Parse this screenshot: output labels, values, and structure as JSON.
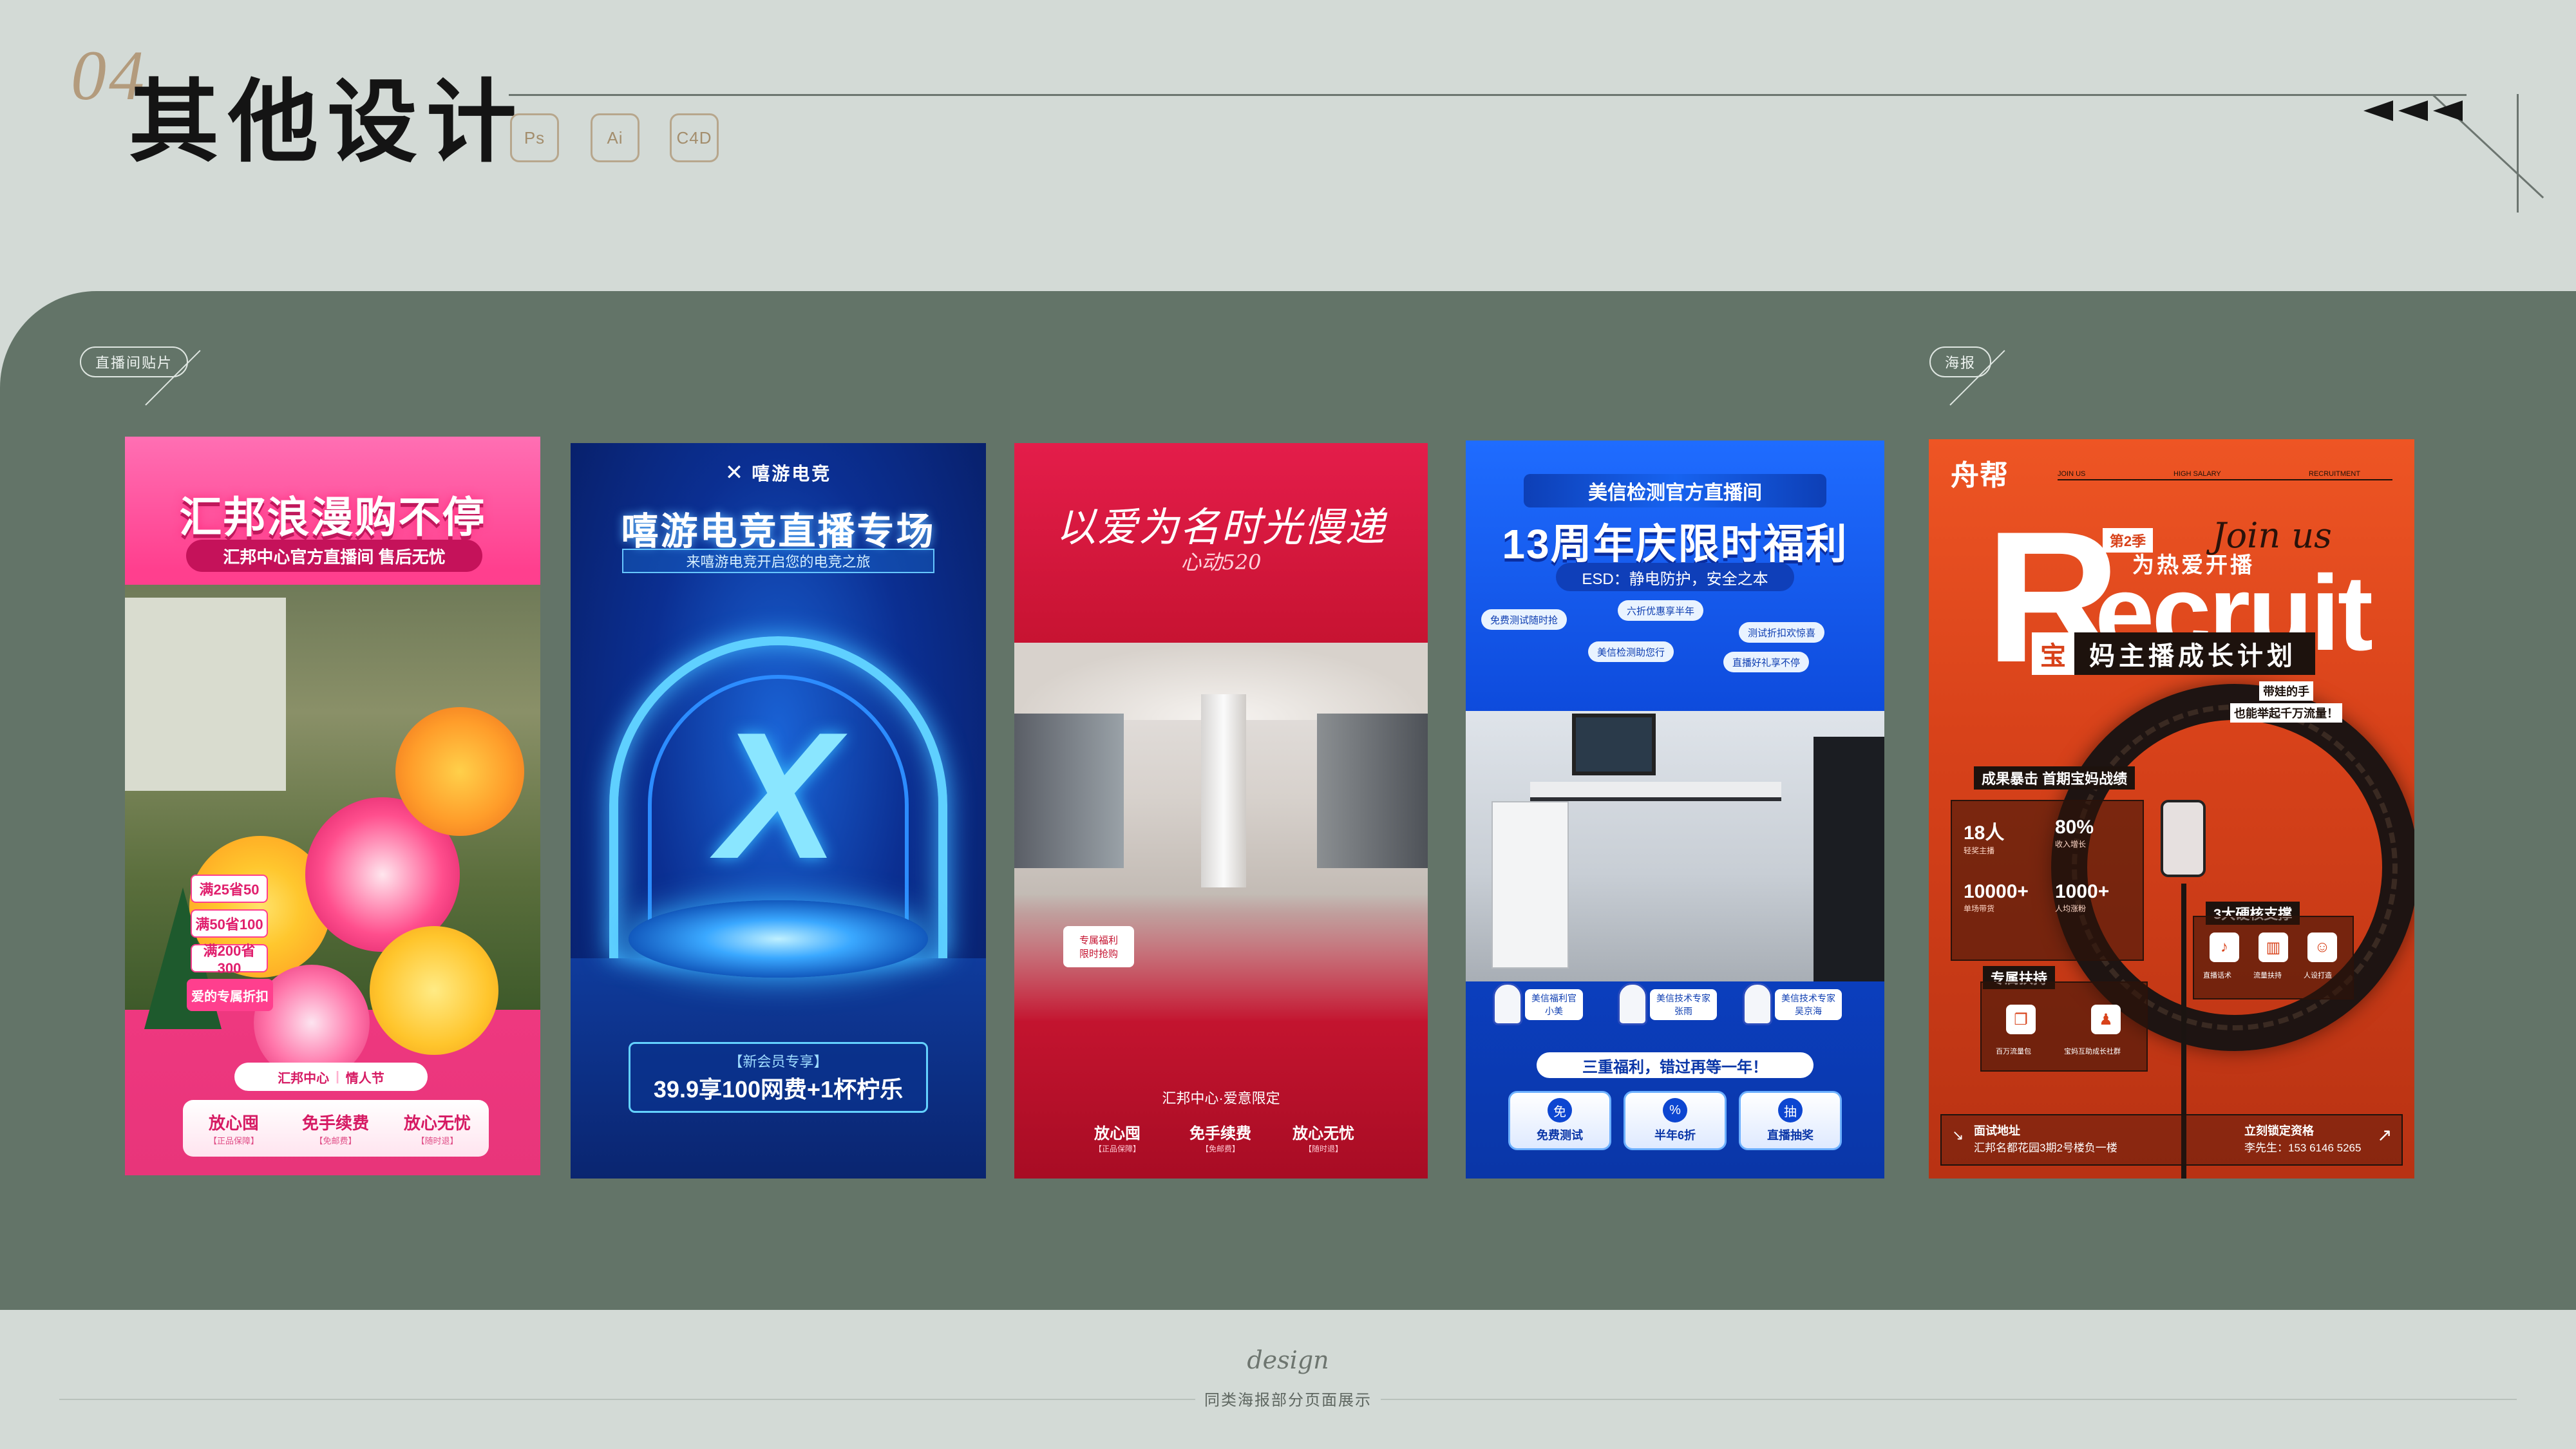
{
  "header": {
    "section_number": "04",
    "title": "其他设计",
    "tools": [
      "Ps",
      "Ai",
      "C4D"
    ]
  },
  "sections": {
    "left_label": "直播间贴片",
    "right_label": "海报"
  },
  "posters": {
    "p1": {
      "title": "汇邦浪漫购不停",
      "subtitle": "汇邦中心官方直播间 售后无忧",
      "brand": "汇邦中心",
      "event": "情人节",
      "prices": [
        "满25省50",
        "满50省100",
        "满200省300"
      ],
      "promo": "爱的专属折扣",
      "guarantees": [
        {
          "main": "放心囤",
          "sub": "【正品保障】"
        },
        {
          "main": "免手续费",
          "sub": "【免邮费】"
        },
        {
          "main": "放心无忧",
          "sub": "【随时退】"
        }
      ],
      "colors": {
        "primary": "#ff3f8e",
        "deep": "#c5125a"
      }
    },
    "p2": {
      "logo": "嘻游电竞",
      "title": "嘻游电竞直播专场",
      "subtitle": "来嘻游电竞开启您的电竞之旅",
      "mark": "X",
      "promo_tag": "【新会员专享】",
      "promo": "39.9享100网费+1杯柠乐",
      "colors": {
        "primary": "#0b2f92",
        "glow": "#5fd0ff"
      }
    },
    "p3": {
      "title": "以爱为名时光慢递",
      "signature": "心动520",
      "tag_line1": "专属福利",
      "tag_line2": "限时抢购",
      "brand": "汇邦中心·爱意限定",
      "guarantees": [
        {
          "main": "放心囤",
          "sub": "【正品保障】"
        },
        {
          "main": "免手续费",
          "sub": "【免邮费】"
        },
        {
          "main": "放心无忧",
          "sub": "【随时退】"
        }
      ],
      "colors": {
        "primary": "#c4122f"
      }
    },
    "p4": {
      "subtitle": "美信检测官方直播间",
      "title": "13周年庆限时福利",
      "esd": "ESD：静电防护，安全之本",
      "chips": [
        "免费测试随时抢",
        "六折优惠享半年",
        "美信检测助您行",
        "测试折扣欢惊喜",
        "直播好礼享不停"
      ],
      "people": [
        {
          "line1": "美信福利官",
          "line2": "小美"
        },
        {
          "line1": "美信技术专家",
          "line2": "张雨"
        },
        {
          "line1": "美信技术专家",
          "line2": "吴京海"
        }
      ],
      "banner": "三重福利，错过再等一年！",
      "buttons": [
        {
          "icon": "免",
          "label": "免费测试"
        },
        {
          "icon": "%",
          "label": "半年6折"
        },
        {
          "icon": "抽",
          "label": "直播抽奖"
        }
      ],
      "colors": {
        "primary": "#0c48d9"
      }
    },
    "p5": {
      "logo": "舟帮",
      "top_texts": [
        "JOIN US",
        "HIGH SALARY",
        "RECRUITMENT"
      ],
      "big_r": "R",
      "ecruit": "ecruit",
      "joinus": "Join us",
      "season": "第2季",
      "passion": "为热爱开播",
      "plan_char": "宝",
      "plan": "妈主播成长计划",
      "tagline1": "带娃的手",
      "tagline2": "也能举起千万流量！",
      "stats_title": "成果暴击 首期宝妈战绩",
      "stats": [
        {
          "value": "18人",
          "label": "轻奖主播"
        },
        {
          "value": "80%",
          "label": "收入增长"
        },
        {
          "value": "10000+",
          "label": "单场带货"
        },
        {
          "value": "1000+",
          "label": "人均涨粉"
        }
      ],
      "support_title": "3大硬核支撑",
      "support": [
        "直播话术",
        "流量扶持",
        "人设打造"
      ],
      "exclusive_title": "专属扶持",
      "exclusive": [
        "百万流量包",
        "宝妈互助成长社群"
      ],
      "address_label": "面试地址",
      "address": "汇邦名都花园3期2号楼负一楼",
      "apply_label": "立刻锁定资格",
      "apply": "李先生：153 6146 5265",
      "colors": {
        "primary": "#d8421a",
        "dark": "#1d120d"
      }
    }
  },
  "footer": {
    "script": "design",
    "caption": "同类海报部分页面展示"
  }
}
